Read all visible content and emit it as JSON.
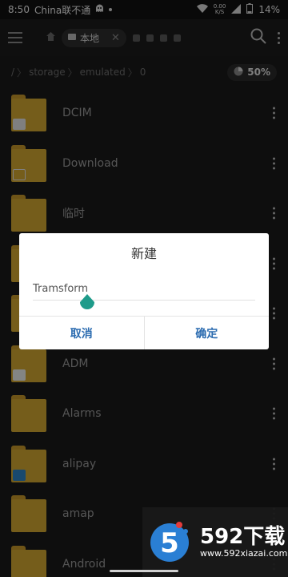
{
  "status_bar": {
    "time": "8:50",
    "carrier": "China联不通",
    "net_speed_value": "0.00",
    "net_speed_unit": "K/S",
    "battery": "14%"
  },
  "toolbar": {
    "active_tab": "本地"
  },
  "path": {
    "root": "/",
    "segments": [
      "storage",
      "emulated",
      "0"
    ],
    "storage_usage": "50%"
  },
  "files": [
    {
      "name": "DCIM",
      "badge": "camera"
    },
    {
      "name": "Download",
      "badge": "download"
    },
    {
      "name": "临时",
      "badge": ""
    },
    {
      "name": "",
      "badge": ""
    },
    {
      "name": "",
      "badge": ""
    },
    {
      "name": "ADM",
      "badge": "app"
    },
    {
      "name": "Alarms",
      "badge": ""
    },
    {
      "name": "alipay",
      "badge": "app-blue"
    },
    {
      "name": "amap",
      "badge": ""
    },
    {
      "name": "Android",
      "badge": ""
    }
  ],
  "dialog": {
    "title": "新建",
    "input_value": "Tramsform",
    "cancel_label": "取消",
    "confirm_label": "确定"
  },
  "watermark": {
    "big": "592下载",
    "small": "www.592xiazai.com"
  },
  "colors": {
    "accent": "#2c6cb0",
    "cursor_handle": "#1e9b8a",
    "folder": "#d6a932"
  }
}
